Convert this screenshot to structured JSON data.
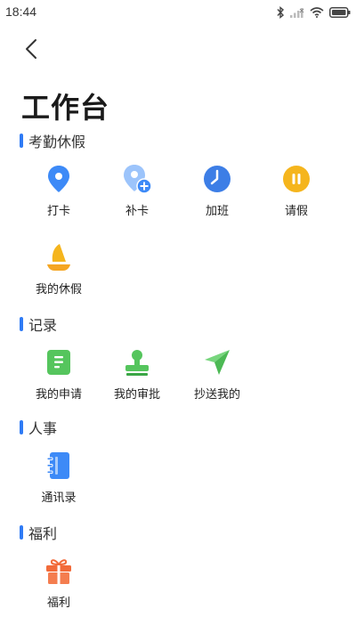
{
  "status_bar": {
    "time": "18:44",
    "icons": [
      "bluetooth-icon",
      "signal-icon",
      "wifi-icon",
      "battery-icon"
    ]
  },
  "nav": {
    "back_icon": "chevron-left-icon"
  },
  "title": "工作台",
  "colors": {
    "accent": "#2f7bf5",
    "blue_icon": "#3d8af7",
    "yellow_icon": "#f5b51d",
    "green_icon": "#55c55d",
    "orange_icon": "#f26b3a"
  },
  "sections": [
    {
      "title": "考勤休假",
      "items": [
        {
          "label": "打卡",
          "icon": "location-pin-icon"
        },
        {
          "label": "补卡",
          "icon": "add-location-icon"
        },
        {
          "label": "加班",
          "icon": "clock-icon"
        },
        {
          "label": "请假",
          "icon": "pause-icon"
        },
        {
          "label": "我的休假",
          "icon": "sailboat-icon"
        }
      ]
    },
    {
      "title": "记录",
      "items": [
        {
          "label": "我的申请",
          "icon": "document-icon"
        },
        {
          "label": "我的审批",
          "icon": "stamp-icon"
        },
        {
          "label": "抄送我的",
          "icon": "send-icon"
        }
      ]
    },
    {
      "title": "人事",
      "items": [
        {
          "label": "通讯录",
          "icon": "contacts-book-icon"
        }
      ]
    },
    {
      "title": "福利",
      "items": [
        {
          "label": "福利",
          "icon": "gift-icon"
        }
      ]
    }
  ]
}
